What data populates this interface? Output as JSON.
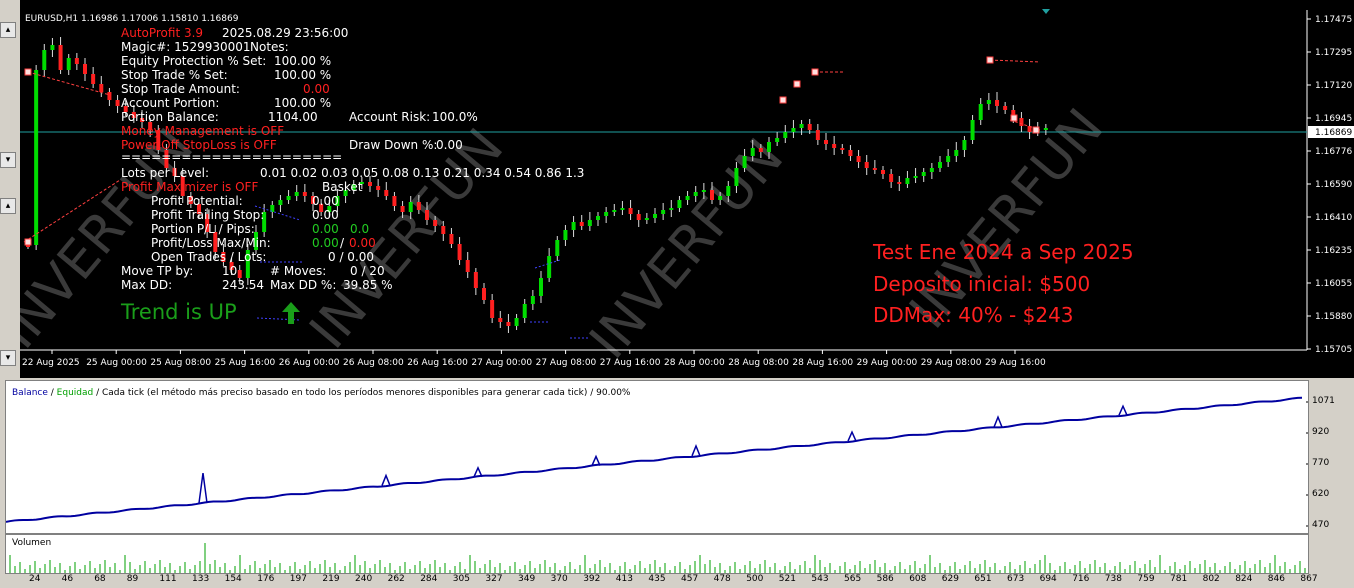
{
  "chart": {
    "header": "EURUSD,H1  1.16986 1.17006 1.15810 1.16869",
    "price_labels": [
      "1.17475",
      "1.17295",
      "1.17120",
      "1.16945",
      "1.16776",
      "1.16590",
      "1.16410",
      "1.16235",
      "1.16055",
      "1.15880",
      "1.15705"
    ],
    "current_price": "1.16869",
    "time_labels": [
      "22 Aug 2025",
      "25 Aug 00:00",
      "25 Aug 08:00",
      "25 Aug 16:00",
      "26 Aug 00:00",
      "26 Aug 08:00",
      "26 Aug 16:00",
      "27 Aug 00:00",
      "27 Aug 08:00",
      "27 Aug 16:00",
      "28 Aug 00:00",
      "28 Aug 08:00",
      "28 Aug 16:00",
      "29 Aug 00:00",
      "29 Aug 08:00",
      "29 Aug 16:00"
    ],
    "watermark": "INVERFUN",
    "colors": {
      "bg": "#000000",
      "bull": "#00dd00",
      "bear": "#ff2020",
      "wick": "#ffffff",
      "bid_line": "#20a0a0"
    }
  },
  "ea_panel": {
    "name": "AutoProfit 3.9",
    "datetime": "2025.08.29 23:56:00",
    "magic": "Magic#: 1529930001",
    "notes": "Notes:",
    "equity_protection_label": "Equity Protection % Set:",
    "equity_protection_value": "100.00 %",
    "stop_trade_label": "Stop Trade % Set:",
    "stop_trade_value": "100.00 %",
    "stop_trade_amount_label": "Stop Trade Amount:",
    "stop_trade_amount_value": "0.00",
    "account_portion_label": "Account Portion:",
    "account_portion_value": "100.00 %",
    "portion_balance_label": "Portion Balance:",
    "portion_balance_value": "1104.00",
    "account_risk_label": "Account Risk:",
    "account_risk_value": "100.0%",
    "money_management": "Money Management is OFF",
    "power_off": "Power-Off StopLoss is OFF",
    "drawdown_label": "Draw Down %:",
    "drawdown_value": "0.00",
    "separator": "======================",
    "lots_label": "Lots per Level:",
    "lots_values": "0.01  0.02  0.03  0.05  0.08  0.13  0.21  0.34  0.54  0.86  1.3",
    "profit_maximizer": "Profit Maximizer is OFF",
    "basket_label": "Basket",
    "profit_potential_label": "Profit Potential:",
    "profit_potential_value": "0.00",
    "profit_trailing_label": "Profit Trailing Stop:",
    "profit_trailing_value": "0.00",
    "portion_pl_label": "Portion P/L / Pips:",
    "portion_pl_value": "0.00",
    "portion_pl_pips": "0.0",
    "profit_loss_label": "Profit/Loss Max/Min:",
    "profit_loss_max": "0.00",
    "profit_loss_sep": "/",
    "profit_loss_min": "0.00",
    "open_trades_label": "Open Trades / Lots:",
    "open_trades_value": "0  /  0.00",
    "move_tp_label": "Move TP by:",
    "move_tp_value": "10",
    "moves_label": "# Moves:",
    "moves_value": "0  /  20",
    "max_dd_label": "Max DD:",
    "max_dd_value": "243.54",
    "max_dd_pct_label": "Max DD %:",
    "max_dd_pct_value": "39.85 %",
    "trend": "Trend is UP",
    "trend_arrow": "up-arrow-icon"
  },
  "annotation": {
    "line1": "Test Ene 2024 a Sep 2025",
    "line2": "Deposito inicial: $500",
    "line3": "DDMax: 40% - $243"
  },
  "tester": {
    "legend_balance": "Balance",
    "legend_sep": " / ",
    "legend_equity": "Equidad",
    "legend_rest": " / Cada tick (el método más preciso basado en todo los períodos menores disponibles para generar cada tick)  / 90.00%",
    "y_labels": [
      "1071",
      "920",
      "770",
      "620",
      "470"
    ],
    "volume_label": "Volumen",
    "x_labels": [
      "24",
      "46",
      "68",
      "89",
      "111",
      "133",
      "154",
      "176",
      "197",
      "219",
      "240",
      "262",
      "284",
      "305",
      "327",
      "349",
      "370",
      "392",
      "413",
      "435",
      "457",
      "478",
      "500",
      "521",
      "543",
      "565",
      "586",
      "608",
      "629",
      "651",
      "673",
      "694",
      "716",
      "738",
      "759",
      "781",
      "802",
      "824",
      "846",
      "867"
    ],
    "colors": {
      "balance": "#0000a0",
      "equity": "#00a000",
      "volume": "#00a000"
    }
  }
}
